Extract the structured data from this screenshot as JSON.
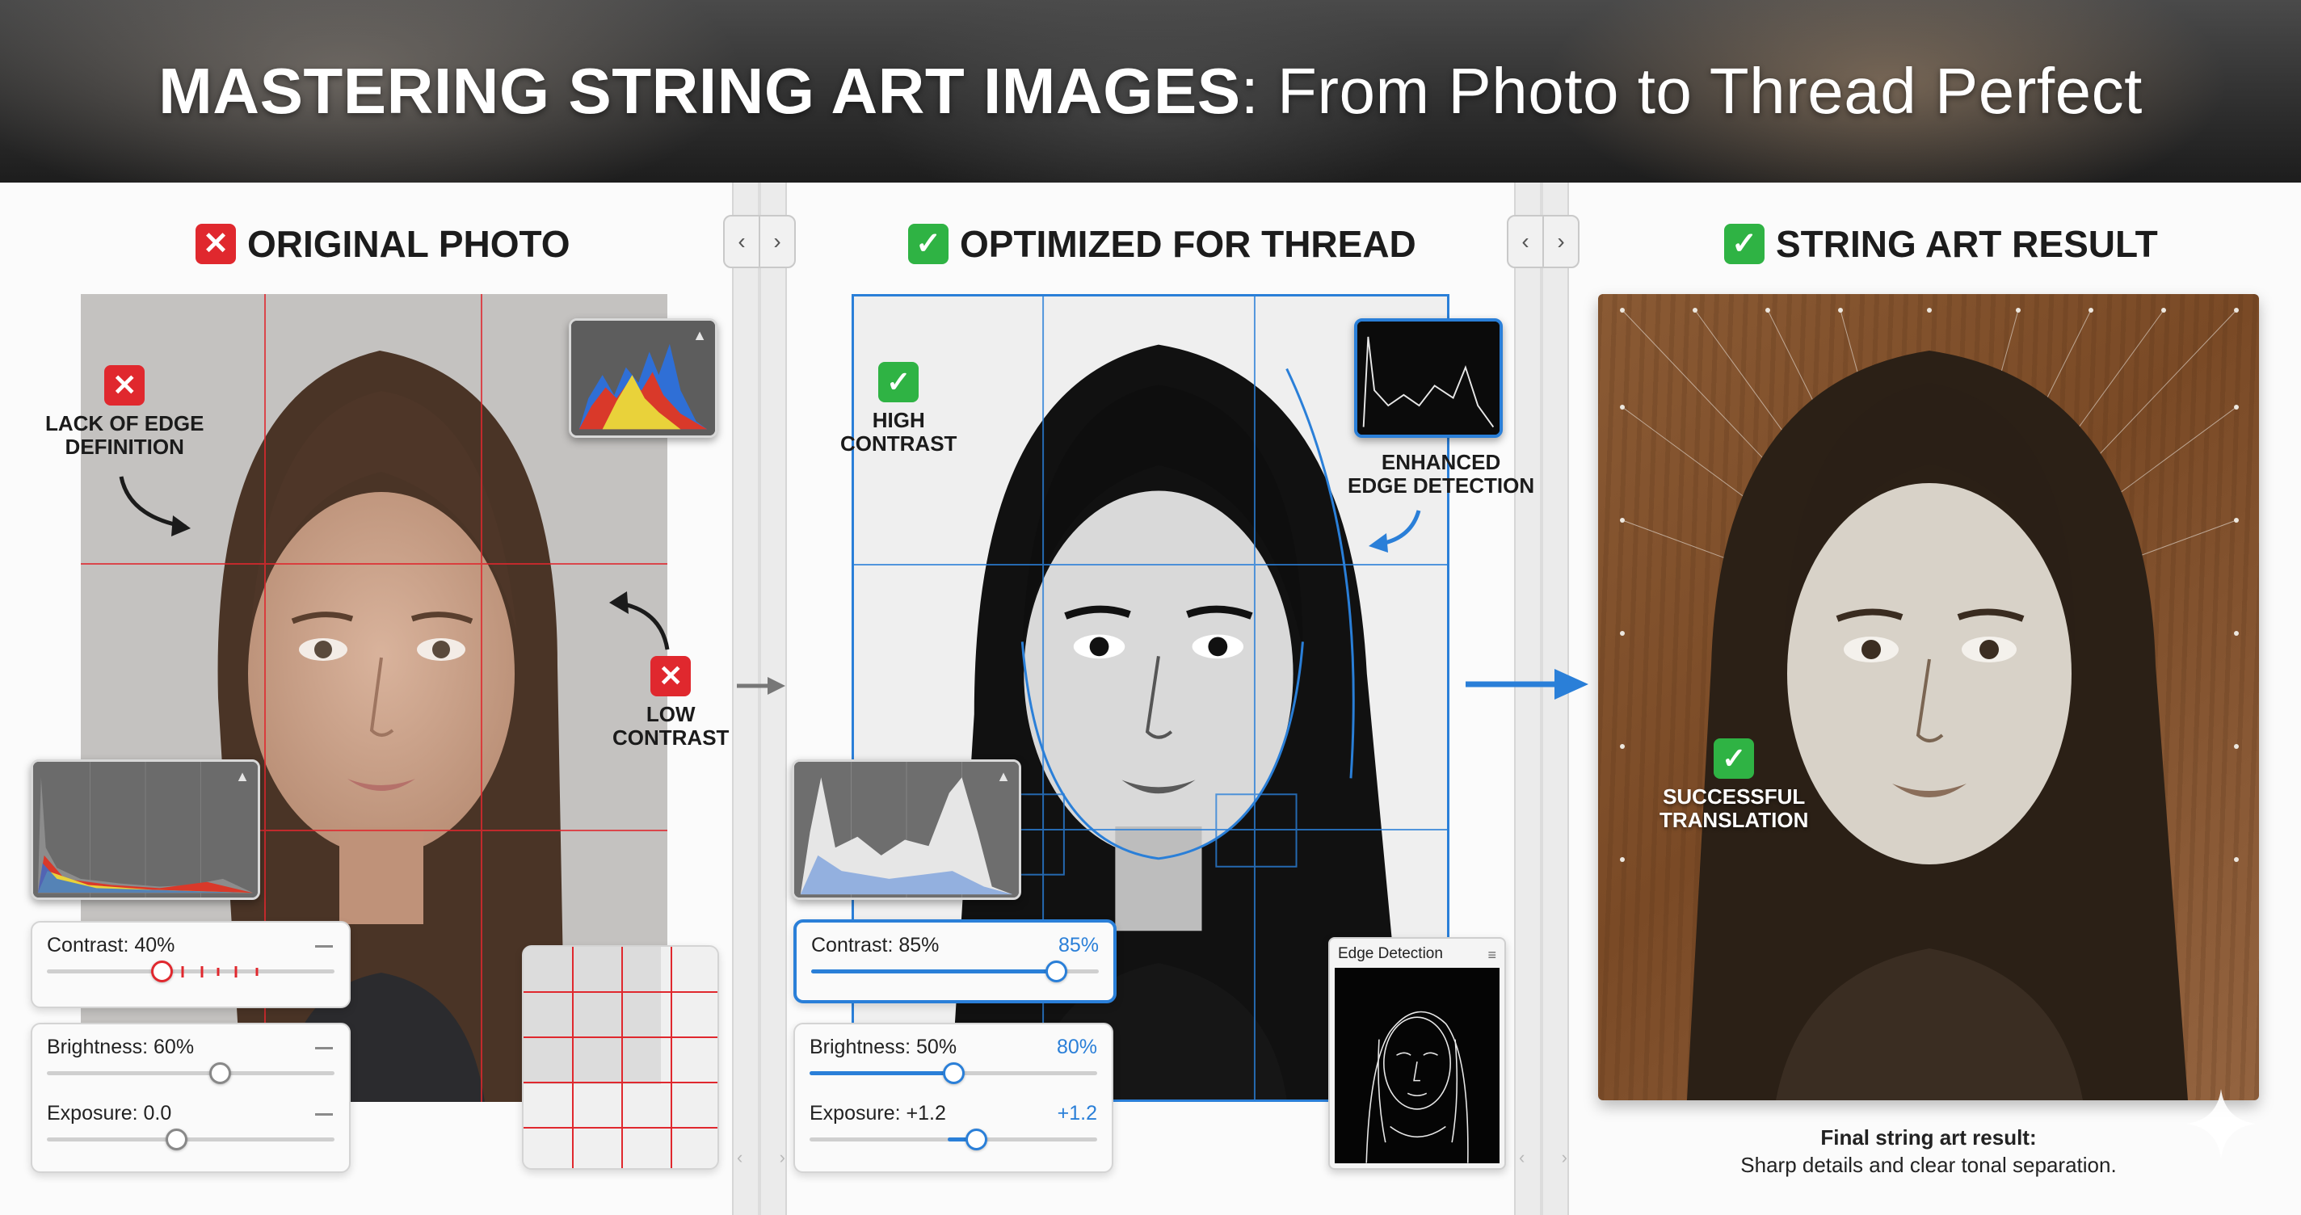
{
  "banner": {
    "title_bold": "MASTERING STRING ART IMAGES",
    "title_rest": ": From Photo to Thread Perfect"
  },
  "panels": [
    {
      "heading": "ORIGINAL PHOTO",
      "status": "x",
      "callouts": [
        {
          "label": "LACK OF EDGE\nDEFINITION",
          "status": "x"
        },
        {
          "label": "LOW\nCONTRAST",
          "status": "x"
        }
      ],
      "sliders": [
        {
          "label": "Contrast: 40%",
          "value": 0.4
        },
        {
          "label": "Brightness: 60%",
          "value": 0.6
        },
        {
          "label": "Exposure: 0.0",
          "value": 0.45
        }
      ]
    },
    {
      "heading": "OPTIMIZED FOR THREAD",
      "status": "check",
      "callouts": [
        {
          "label": "HIGH\nCONTRAST",
          "status": "check"
        },
        {
          "label": "ENHANCED\nEDGE DETECTION",
          "status": "none"
        }
      ],
      "sliders": [
        {
          "label": "Contrast: 85%",
          "readout": "85%",
          "value": 0.85
        },
        {
          "label": "Brightness: 50%",
          "readout": "80%",
          "value": 0.5
        },
        {
          "label": "Exposure: +1.2",
          "readout": "+1.2",
          "value": 0.58
        }
      ],
      "edge_panel_title": "Edge Detection"
    },
    {
      "heading": "STRING ART RESULT",
      "status": "check",
      "callouts": [
        {
          "label": "SUCCESSFUL\nTRANSLATION",
          "status": "check"
        }
      ],
      "caption_bold": "Final string art result:",
      "caption": "Sharp details and clear tonal separation."
    }
  ],
  "icons": {
    "x_mark": "✕",
    "check_mark": "✓",
    "nav_prev": "‹",
    "nav_next": "›",
    "warning": "▲",
    "menu": "≡"
  },
  "colors": {
    "accent_blue": "#2a7fd8",
    "error_red": "#e0282e",
    "success_green": "#2fb344"
  }
}
